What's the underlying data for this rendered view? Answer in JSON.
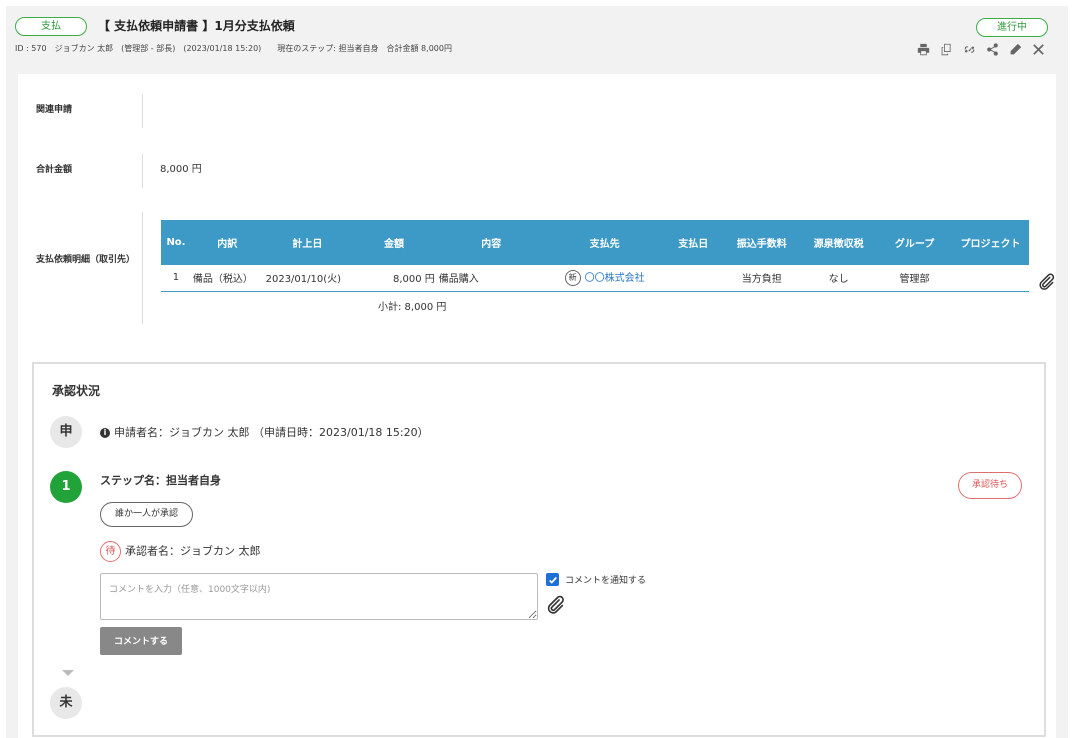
{
  "header": {
    "type_pill": "支払",
    "title": "【 支払依頼申請書 】1月分支払依頼",
    "status": "進行中",
    "meta": "ID : 570　ジョブカン 太郎　(管理部 - 部長)　(2023/01/18 15:20)　　現在のステップ: 担当者自身　合計金額 8,000円",
    "toolbar_icons": [
      "print-icon",
      "copy-icon",
      "link-icon",
      "share-icon",
      "pencil-icon",
      "close-icon"
    ]
  },
  "fields": {
    "related_label": "関連申請",
    "related_value": "",
    "total_label": "合計金額",
    "total_value": "8,000 円",
    "detail_label": "支払依頼明細（取引先）"
  },
  "detail_table": {
    "headers": [
      "No.",
      "内訳",
      "計上日",
      "金額",
      "内容",
      "支払先",
      "支払日",
      "振込手数料",
      "源泉徴収税",
      "グループ",
      "プロジェクト"
    ],
    "rows": [
      {
        "no": "1",
        "breakdown": "備品（税込）",
        "date": "2023/01/10(火)",
        "amount": "8,000 円",
        "content": "備品購入",
        "payee_badge": "新",
        "payee": "〇〇株式会社",
        "pay_date": "",
        "fee": "当方負担",
        "withholding": "なし",
        "group": "管理部",
        "project": ""
      }
    ],
    "subtotal": "小計: 8,000 円"
  },
  "approval": {
    "title": "承認状況",
    "applicant_circle": "申",
    "applicant_text": "申請者名：ジョブカン 太郎 （申請日時：2023/01/18 15:20）",
    "step_circle": "1",
    "step_name": "ステップ名：担当者自身",
    "anyone_pill": "誰か一人が承認",
    "waiting_pill": "承認待ち",
    "wait_badge": "待",
    "approver_text": "承認者名：ジョブカン 太郎",
    "comment_placeholder": "コメントを入力（任意、1000文字以内)",
    "notify_label": "コメントを通知する",
    "notify_checked": true,
    "comment_button": "コメントする",
    "pending_circle": "未"
  },
  "colors": {
    "accent_green": "#22a33a",
    "table_header_blue": "#3d9ac7",
    "link_blue": "#2a77c9",
    "waiting_red": "#e07070"
  }
}
